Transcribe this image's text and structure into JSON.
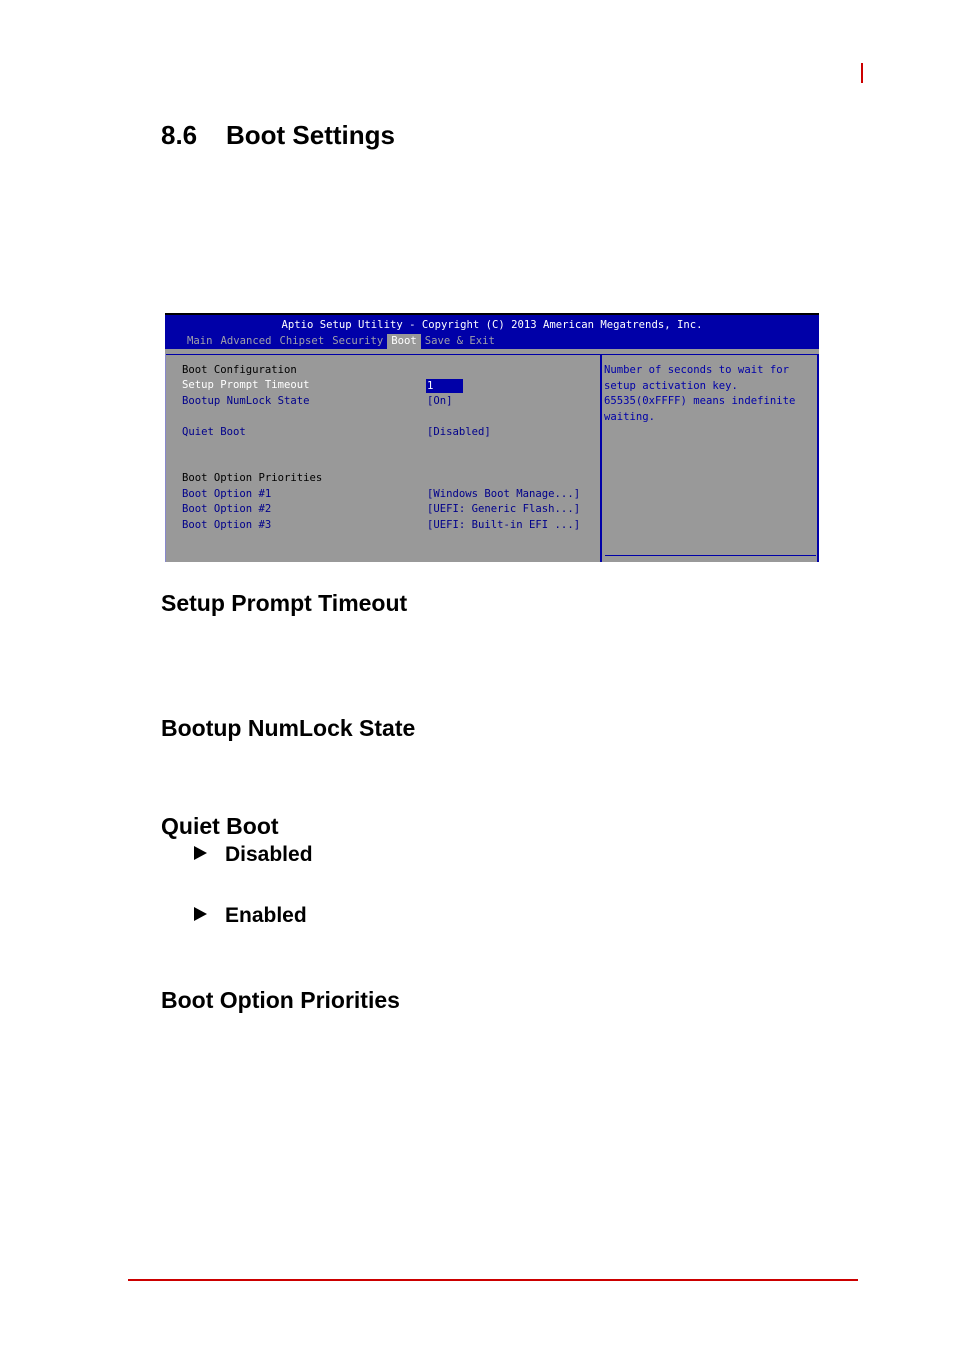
{
  "page": {
    "section_number": "8.6",
    "section_title": "Boot Settings",
    "accent_color": "#cc0000"
  },
  "bios": {
    "title": "Aptio Setup Utility - Copyright (C) 2013 American Megatrends, Inc.",
    "tabs": [
      {
        "label": "Main",
        "active": false
      },
      {
        "label": "Advanced",
        "active": false
      },
      {
        "label": "Chipset",
        "active": false
      },
      {
        "label": "Security",
        "active": false
      },
      {
        "label": "Boot",
        "active": true
      },
      {
        "label": "Save & Exit",
        "active": false
      }
    ],
    "rows": {
      "boot_configuration": "Boot Configuration",
      "setup_prompt_timeout": {
        "label": "Setup Prompt Timeout",
        "value": "1"
      },
      "bootup_numlock_state": {
        "label": "Bootup NumLock State",
        "value": "[On]"
      },
      "quiet_boot": {
        "label": "Quiet Boot",
        "value": "[Disabled]"
      },
      "boot_option_priorities": "Boot Option Priorities",
      "boot_option_1": {
        "label": "Boot Option #1",
        "value": "[Windows Boot Manage...]"
      },
      "boot_option_2": {
        "label": "Boot Option #2",
        "value": "[UEFI: Generic Flash...]"
      },
      "boot_option_3": {
        "label": "Boot Option #3",
        "value": "[UEFI: Built-in EFI ...]"
      }
    },
    "help_lines": [
      "Number of seconds to wait for",
      "setup activation key.",
      "65535(0xFFFF) means indefinite",
      "waiting."
    ],
    "colors": {
      "title_bar": "#0000a8",
      "background": "#999999",
      "option_text": "#00008b"
    }
  },
  "headings": {
    "setup_prompt_timeout": "Setup Prompt Timeout",
    "bootup_numlock_state": "Bootup NumLock State",
    "quiet_boot": "Quiet Boot",
    "boot_option_priorities": "Boot Option Priorities"
  },
  "quiet_boot_options": [
    "Disabled",
    "Enabled"
  ]
}
